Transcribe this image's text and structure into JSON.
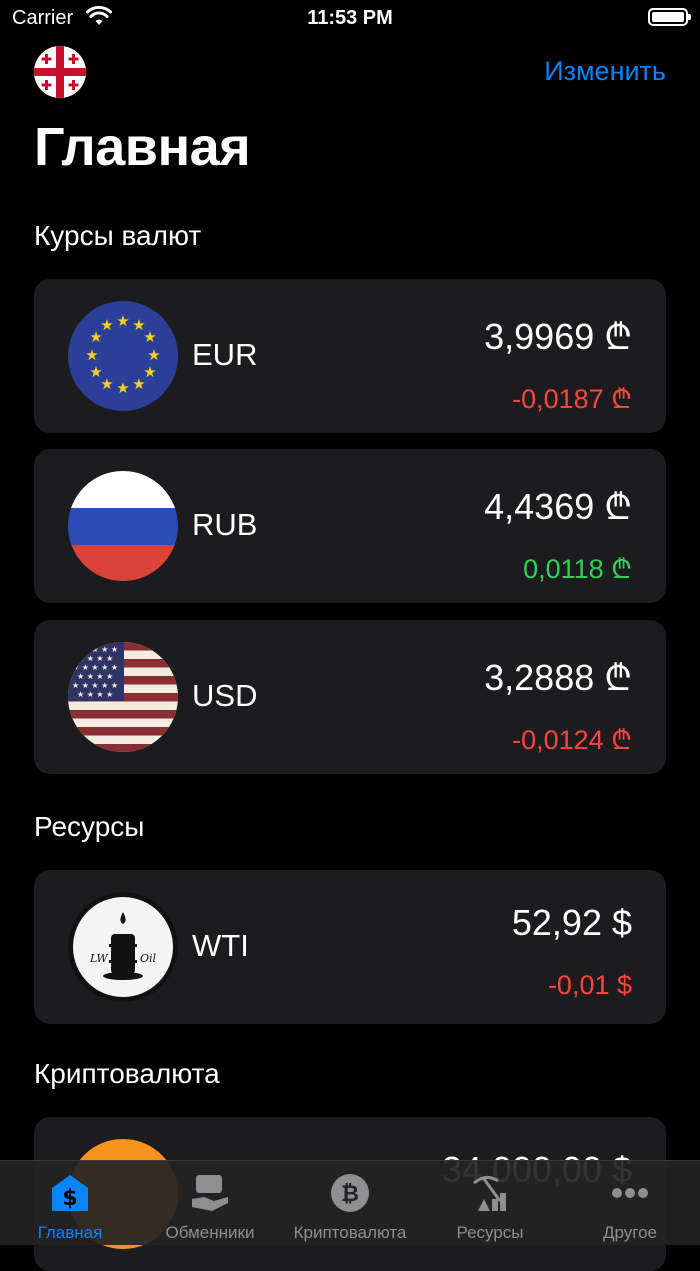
{
  "status_bar": {
    "carrier": "Carrier",
    "time": "11:53 PM"
  },
  "nav": {
    "edit_label": "Изменить",
    "title": "Главная"
  },
  "sections": {
    "currencies": "Курсы валют",
    "resources": "Ресурсы",
    "crypto": "Криптовалюта"
  },
  "currency_cards": [
    {
      "code": "EUR",
      "price": "3,9969 ₾",
      "change": "-0,0187 ₾",
      "direction": "down",
      "icon": "eu-flag-icon"
    },
    {
      "code": "RUB",
      "price": "4,4369 ₾",
      "change": "0,0118 ₾",
      "direction": "up",
      "icon": "russia-flag-icon"
    },
    {
      "code": "USD",
      "price": "3,2888 ₾",
      "change": "-0,0124 ₾",
      "direction": "down",
      "icon": "usa-flag-icon"
    }
  ],
  "resource_cards": [
    {
      "code": "WTI",
      "price": "52,92 $",
      "change": "-0,01 $",
      "direction": "down",
      "icon": "oil-barrel-icon"
    }
  ],
  "crypto_cards": [
    {
      "price": "34 000,00 $",
      "icon": "bitcoin-icon"
    }
  ],
  "tabs": [
    {
      "label": "Главная",
      "icon": "dollar-house-icon",
      "active": true
    },
    {
      "label": "Обменники",
      "icon": "exchange-hand-icon",
      "active": false
    },
    {
      "label": "Криптовалюта",
      "icon": "bitcoin-icon",
      "active": false
    },
    {
      "label": "Ресурсы",
      "icon": "pickaxe-icon",
      "active": false
    },
    {
      "label": "Другое",
      "icon": "more-dots-icon",
      "active": false
    }
  ],
  "colors": {
    "accent": "#0a84ff",
    "negative": "#ff453a",
    "positive": "#30d158",
    "card": "#1c1c1e"
  }
}
